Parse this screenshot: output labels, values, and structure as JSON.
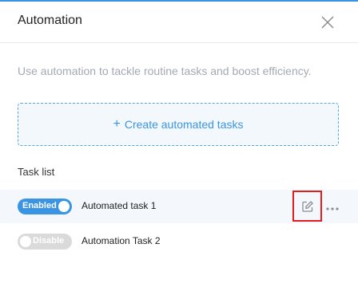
{
  "dialog": {
    "title": "Automation",
    "description": "Use automation to tackle routine tasks and boost efficiency.",
    "create_label": "Create automated tasks",
    "create_icon": "plus-icon",
    "close_icon": "close-icon"
  },
  "task_list": {
    "title": "Task list",
    "tasks": [
      {
        "name": "Automated task 1",
        "toggle_label": "Enabled",
        "enabled": true
      },
      {
        "name": "Automation Task 2",
        "toggle_label": "Disable",
        "enabled": false
      }
    ],
    "edit_icon": "edit-icon",
    "more_icon": "more-horizontal-icon"
  },
  "colors": {
    "accent": "#3a94e4",
    "highlight_border": "#e51c1c",
    "disabled_toggle": "#dadada",
    "active_row_bg": "#f4f8fc"
  }
}
